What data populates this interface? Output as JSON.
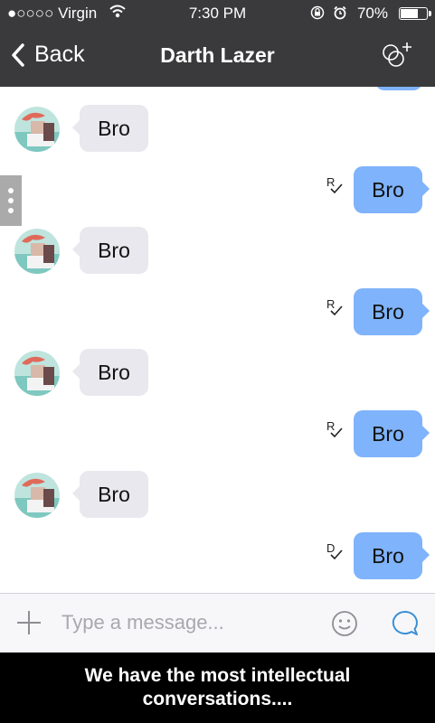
{
  "status_bar": {
    "carrier": "●○○○○ Virgin",
    "time": "7:30 PM",
    "battery_text": "70%",
    "battery_level": 0.7
  },
  "nav": {
    "back_label": "Back",
    "title": "Darth Lazer",
    "add_icon": "add-contact-icon"
  },
  "messages": [
    {
      "side": "in",
      "text": "Bro"
    },
    {
      "side": "out",
      "text": "Bro",
      "receipt": "R"
    },
    {
      "side": "in",
      "text": "Bro"
    },
    {
      "side": "out",
      "text": "Bro",
      "receipt": "R"
    },
    {
      "side": "in",
      "text": "Bro"
    },
    {
      "side": "out",
      "text": "Bro",
      "receipt": "R"
    },
    {
      "side": "in",
      "text": "Bro"
    },
    {
      "side": "out",
      "text": "Bro",
      "receipt": "D"
    }
  ],
  "input": {
    "placeholder": "Type a message...",
    "value": ""
  },
  "colors": {
    "header_bg": "#3a3a3c",
    "outgoing_bubble": "#7fb3fb",
    "incoming_bubble": "#e8e8ee",
    "send_icon": "#3a8fd6"
  },
  "caption": {
    "line1": "We have the most intellectual",
    "line2": "conversations...."
  }
}
